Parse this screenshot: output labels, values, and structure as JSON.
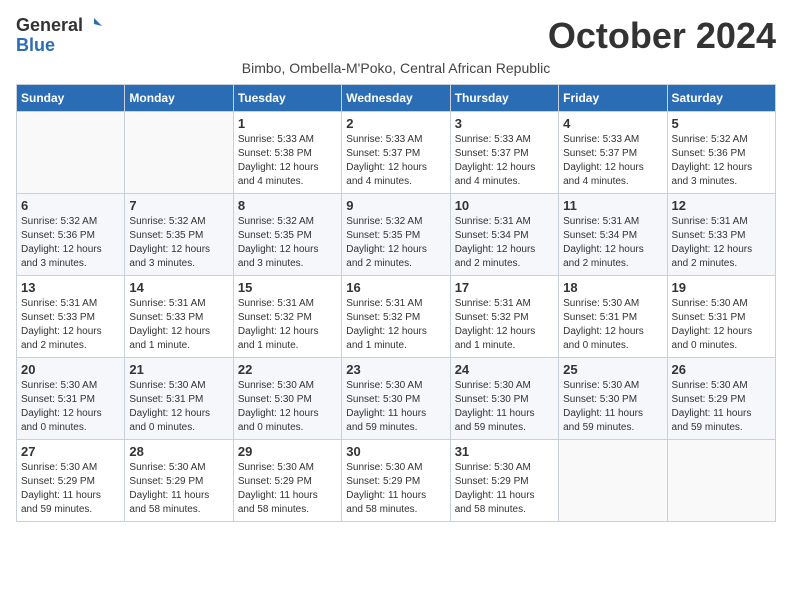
{
  "logo": {
    "general": "General",
    "blue": "Blue"
  },
  "title": "October 2024",
  "subtitle": "Bimbo, Ombella-M'Poko, Central African Republic",
  "days_of_week": [
    "Sunday",
    "Monday",
    "Tuesday",
    "Wednesday",
    "Thursday",
    "Friday",
    "Saturday"
  ],
  "weeks": [
    [
      {
        "day": "",
        "content": ""
      },
      {
        "day": "",
        "content": ""
      },
      {
        "day": "1",
        "content": "Sunrise: 5:33 AM\nSunset: 5:38 PM\nDaylight: 12 hours\nand 4 minutes."
      },
      {
        "day": "2",
        "content": "Sunrise: 5:33 AM\nSunset: 5:37 PM\nDaylight: 12 hours\nand 4 minutes."
      },
      {
        "day": "3",
        "content": "Sunrise: 5:33 AM\nSunset: 5:37 PM\nDaylight: 12 hours\nand 4 minutes."
      },
      {
        "day": "4",
        "content": "Sunrise: 5:33 AM\nSunset: 5:37 PM\nDaylight: 12 hours\nand 4 minutes."
      },
      {
        "day": "5",
        "content": "Sunrise: 5:32 AM\nSunset: 5:36 PM\nDaylight: 12 hours\nand 3 minutes."
      }
    ],
    [
      {
        "day": "6",
        "content": "Sunrise: 5:32 AM\nSunset: 5:36 PM\nDaylight: 12 hours\nand 3 minutes."
      },
      {
        "day": "7",
        "content": "Sunrise: 5:32 AM\nSunset: 5:35 PM\nDaylight: 12 hours\nand 3 minutes."
      },
      {
        "day": "8",
        "content": "Sunrise: 5:32 AM\nSunset: 5:35 PM\nDaylight: 12 hours\nand 3 minutes."
      },
      {
        "day": "9",
        "content": "Sunrise: 5:32 AM\nSunset: 5:35 PM\nDaylight: 12 hours\nand 2 minutes."
      },
      {
        "day": "10",
        "content": "Sunrise: 5:31 AM\nSunset: 5:34 PM\nDaylight: 12 hours\nand 2 minutes."
      },
      {
        "day": "11",
        "content": "Sunrise: 5:31 AM\nSunset: 5:34 PM\nDaylight: 12 hours\nand 2 minutes."
      },
      {
        "day": "12",
        "content": "Sunrise: 5:31 AM\nSunset: 5:33 PM\nDaylight: 12 hours\nand 2 minutes."
      }
    ],
    [
      {
        "day": "13",
        "content": "Sunrise: 5:31 AM\nSunset: 5:33 PM\nDaylight: 12 hours\nand 2 minutes."
      },
      {
        "day": "14",
        "content": "Sunrise: 5:31 AM\nSunset: 5:33 PM\nDaylight: 12 hours\nand 1 minute."
      },
      {
        "day": "15",
        "content": "Sunrise: 5:31 AM\nSunset: 5:32 PM\nDaylight: 12 hours\nand 1 minute."
      },
      {
        "day": "16",
        "content": "Sunrise: 5:31 AM\nSunset: 5:32 PM\nDaylight: 12 hours\nand 1 minute."
      },
      {
        "day": "17",
        "content": "Sunrise: 5:31 AM\nSunset: 5:32 PM\nDaylight: 12 hours\nand 1 minute."
      },
      {
        "day": "18",
        "content": "Sunrise: 5:30 AM\nSunset: 5:31 PM\nDaylight: 12 hours\nand 0 minutes."
      },
      {
        "day": "19",
        "content": "Sunrise: 5:30 AM\nSunset: 5:31 PM\nDaylight: 12 hours\nand 0 minutes."
      }
    ],
    [
      {
        "day": "20",
        "content": "Sunrise: 5:30 AM\nSunset: 5:31 PM\nDaylight: 12 hours\nand 0 minutes."
      },
      {
        "day": "21",
        "content": "Sunrise: 5:30 AM\nSunset: 5:31 PM\nDaylight: 12 hours\nand 0 minutes."
      },
      {
        "day": "22",
        "content": "Sunrise: 5:30 AM\nSunset: 5:30 PM\nDaylight: 12 hours\nand 0 minutes."
      },
      {
        "day": "23",
        "content": "Sunrise: 5:30 AM\nSunset: 5:30 PM\nDaylight: 11 hours\nand 59 minutes."
      },
      {
        "day": "24",
        "content": "Sunrise: 5:30 AM\nSunset: 5:30 PM\nDaylight: 11 hours\nand 59 minutes."
      },
      {
        "day": "25",
        "content": "Sunrise: 5:30 AM\nSunset: 5:30 PM\nDaylight: 11 hours\nand 59 minutes."
      },
      {
        "day": "26",
        "content": "Sunrise: 5:30 AM\nSunset: 5:29 PM\nDaylight: 11 hours\nand 59 minutes."
      }
    ],
    [
      {
        "day": "27",
        "content": "Sunrise: 5:30 AM\nSunset: 5:29 PM\nDaylight: 11 hours\nand 59 minutes."
      },
      {
        "day": "28",
        "content": "Sunrise: 5:30 AM\nSunset: 5:29 PM\nDaylight: 11 hours\nand 58 minutes."
      },
      {
        "day": "29",
        "content": "Sunrise: 5:30 AM\nSunset: 5:29 PM\nDaylight: 11 hours\nand 58 minutes."
      },
      {
        "day": "30",
        "content": "Sunrise: 5:30 AM\nSunset: 5:29 PM\nDaylight: 11 hours\nand 58 minutes."
      },
      {
        "day": "31",
        "content": "Sunrise: 5:30 AM\nSunset: 5:29 PM\nDaylight: 11 hours\nand 58 minutes."
      },
      {
        "day": "",
        "content": ""
      },
      {
        "day": "",
        "content": ""
      }
    ]
  ]
}
